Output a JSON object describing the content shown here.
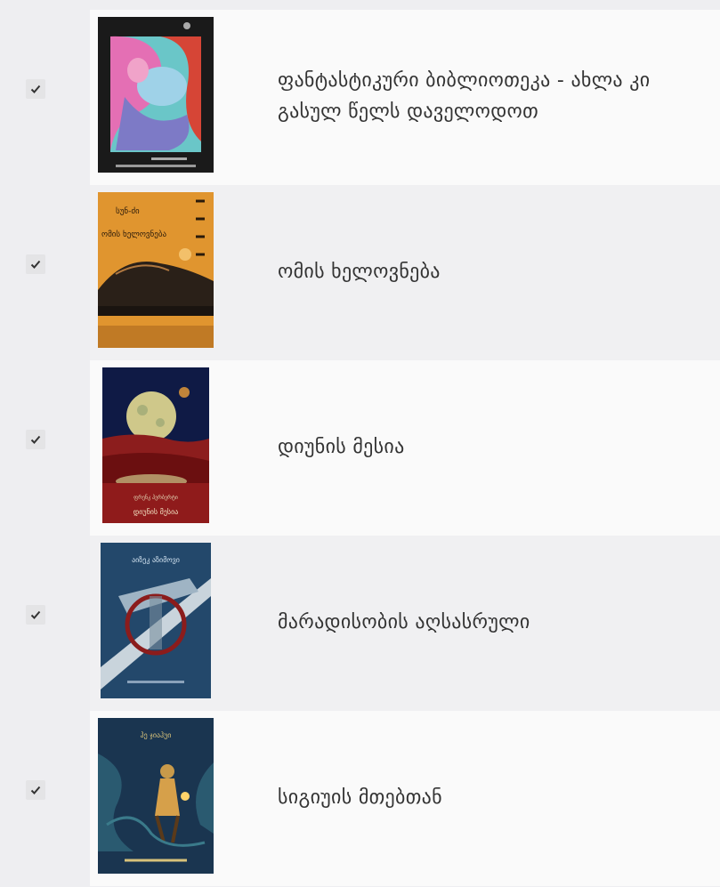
{
  "items": [
    {
      "title": "ფანტასტიკური ბიბლიოთეკა - ახლა კი გასულ წელს დაველოდოთ",
      "checked": true,
      "cover_icon": "fantasy-library-cover"
    },
    {
      "title": "ომის ხელოვნება",
      "checked": true,
      "cover_icon": "art-of-war-cover",
      "cover_lines": [
        "სუნ-ძი",
        "ომის ხელოვნება"
      ]
    },
    {
      "title": "დიუნის მესია",
      "checked": true,
      "cover_icon": "dune-messiah-cover",
      "cover_lines": [
        "ფრენკ ჰერბერტი",
        "დიუნის მესია"
      ]
    },
    {
      "title": "მარადისობის აღსასრული",
      "checked": true,
      "cover_icon": "end-of-eternity-cover",
      "cover_lines": [
        "აიზეკ აზიმოვი"
      ]
    },
    {
      "title": "სიგიუის მთებთან",
      "checked": true,
      "cover_icon": "sigiu-mountains-cover",
      "cover_lines": [
        "ჰე ჯიაჰუი"
      ]
    }
  ],
  "colors": {
    "row_light": "#fafafa",
    "row_dark": "#f0f0f2",
    "page_bg": "#eeeef1",
    "text": "#333333"
  }
}
